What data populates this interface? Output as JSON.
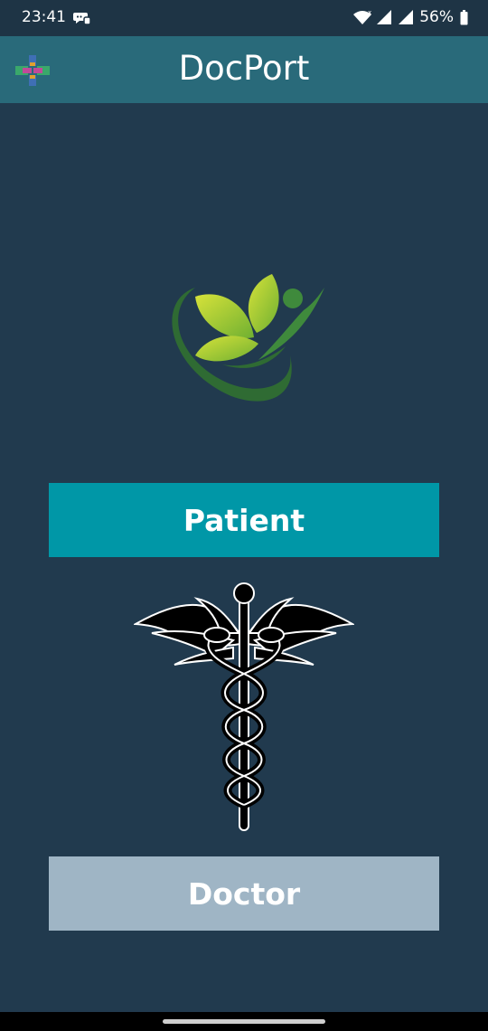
{
  "status_bar": {
    "time": "23:41",
    "battery": "56%",
    "icons": [
      "chat-icon",
      "wifi-icon",
      "signal-icon",
      "battery-icon"
    ]
  },
  "app_bar": {
    "title": "DocPort",
    "logo_icon": "docport-logo-icon"
  },
  "hero": {
    "icon": "leaf-person-logo"
  },
  "roles": {
    "patient_label": "Patient",
    "doctor_label": "Doctor"
  },
  "colors": {
    "background": "#213a4e",
    "app_bar": "#296a7a",
    "patient_button": "#0097a7",
    "doctor_button": "#9fb5c5"
  }
}
